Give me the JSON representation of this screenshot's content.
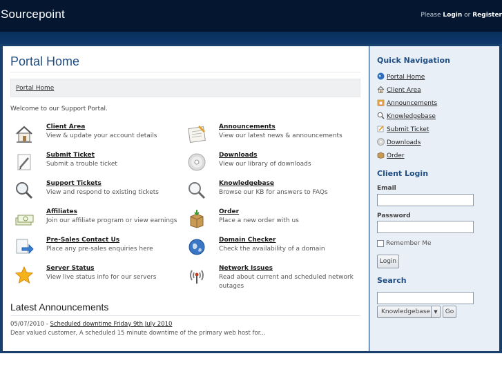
{
  "header": {
    "brand": "Sourcepoint",
    "auth_prefix": "Please",
    "login": "Login",
    "or": "or",
    "register": "Register"
  },
  "main": {
    "title": "Portal Home",
    "breadcrumb": "Portal Home",
    "welcome": "Welcome to our Support Portal.",
    "items": [
      {
        "label": "Client Area",
        "desc": "View & update your account details",
        "icon": "house-icon"
      },
      {
        "label": "Announcements",
        "desc": "View our latest news & announcements",
        "icon": "notepad-icon"
      },
      {
        "label": "Submit Ticket",
        "desc": "Submit a trouble ticket",
        "icon": "pencil-paper-icon"
      },
      {
        "label": "Downloads",
        "desc": "View our library of downloads",
        "icon": "disc-icon"
      },
      {
        "label": "Support Tickets",
        "desc": "View and respond to existing tickets",
        "icon": "magnifier-icon"
      },
      {
        "label": "Knowledgebase",
        "desc": "Browse our KB for answers to FAQs",
        "icon": "magnifier-icon"
      },
      {
        "label": "Affiliates",
        "desc": "Join our affiliate program or view earnings",
        "icon": "cash-icon"
      },
      {
        "label": "Order",
        "desc": "Place a new order with us",
        "icon": "box-icon"
      },
      {
        "label": "Pre-Sales Contact Us",
        "desc": "Place any pre-sales enquiries here",
        "icon": "arrow-doc-icon"
      },
      {
        "label": "Domain Checker",
        "desc": "Check the availability of a domain",
        "icon": "globe-icon"
      },
      {
        "label": "Server Status",
        "desc": "View live status info for our servers",
        "icon": "star-icon"
      },
      {
        "label": "Network Issues",
        "desc": "Read about current and scheduled network outages",
        "icon": "antenna-icon"
      }
    ],
    "announcements_title": "Latest Announcements",
    "announcement": {
      "date": "05/07/2010",
      "sep": " - ",
      "title": "Scheduled downtime Friday 9th July 2010",
      "excerpt": "Dear valued customer,   A scheduled 15 minute downtime of the primary web host for..."
    }
  },
  "sidebar": {
    "quick_nav_title": "Quick Navigation",
    "quick_nav": [
      {
        "label": "Portal Home",
        "icon": "globe-icon"
      },
      {
        "label": "Client Area",
        "icon": "house-icon"
      },
      {
        "label": "Announcements",
        "icon": "folder-icon"
      },
      {
        "label": "Knowledgebase",
        "icon": "magnifier-icon"
      },
      {
        "label": "Submit Ticket",
        "icon": "pencil-paper-icon"
      },
      {
        "label": "Downloads",
        "icon": "disc-icon"
      },
      {
        "label": "Order",
        "icon": "box-icon"
      }
    ],
    "login_title": "Client Login",
    "email_label": "Email",
    "email_value": "",
    "password_label": "Password",
    "password_value": "",
    "remember_label": "Remember Me",
    "login_button": "Login",
    "search_title": "Search",
    "search_value": "",
    "search_scope": "Knowledgebase",
    "go_button": "Go"
  },
  "colors": {
    "topbar": "#041630",
    "accent": "#1f4e84",
    "frame": "#17406f"
  }
}
